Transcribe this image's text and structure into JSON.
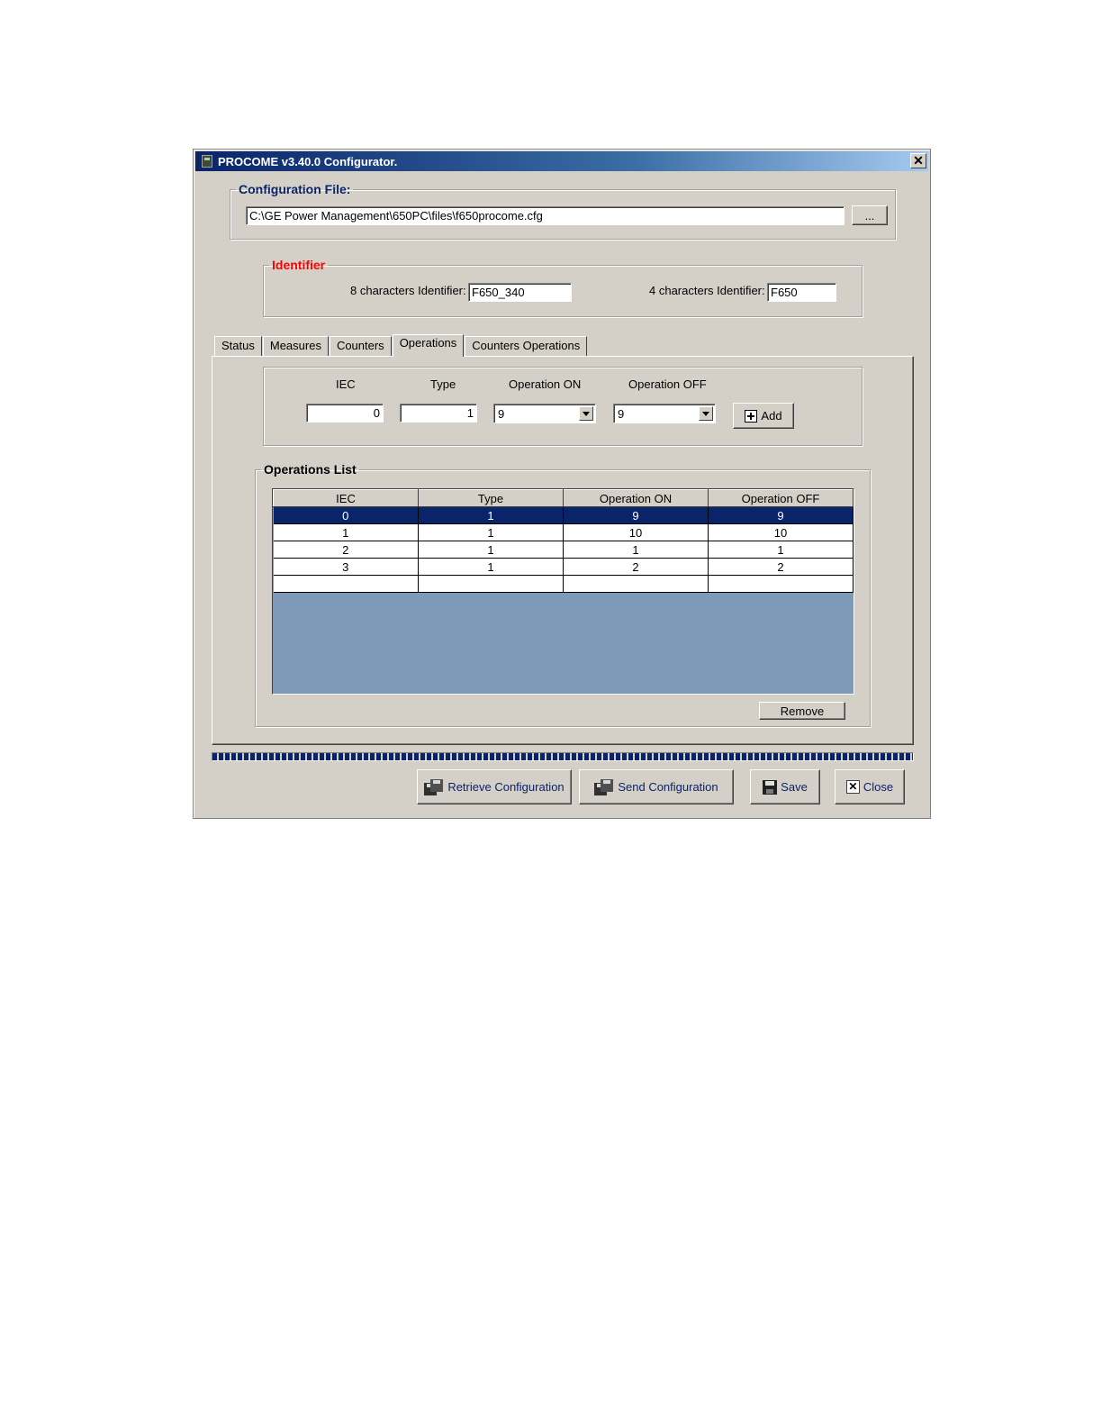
{
  "window": {
    "title": "PROCOME v3.40.0 Configurator."
  },
  "config_file": {
    "legend": "Configuration File:",
    "path": "C:\\GE Power Management\\650PC\\files\\f650procome.cfg",
    "browse_label": "..."
  },
  "identifier": {
    "legend": "Identifier",
    "legend_color": "#ff0000",
    "eight_label": "8 characters Identifier:",
    "eight_value": "F650_340",
    "four_label": "4 characters Identifier:",
    "four_value": "F650"
  },
  "tabs": [
    "Status",
    "Measures",
    "Counters",
    "Operations",
    "Counters Operations"
  ],
  "active_tab": "Operations",
  "entry": {
    "iec_label": "IEC",
    "type_label": "Type",
    "on_label": "Operation ON",
    "off_label": "Operation OFF",
    "iec_value": "0",
    "type_value": "1",
    "on_value": "9",
    "off_value": "9",
    "add_label": "Add"
  },
  "operations_list": {
    "legend": "Operations List",
    "columns": [
      "IEC",
      "Type",
      "Operation ON",
      "Operation OFF"
    ],
    "rows": [
      [
        "0",
        "1",
        "9",
        "9"
      ],
      [
        "1",
        "1",
        "10",
        "10"
      ],
      [
        "2",
        "1",
        "1",
        "1"
      ],
      [
        "3",
        "1",
        "2",
        "2"
      ],
      [
        "",
        "",
        "",
        ""
      ]
    ],
    "selected_row": 0,
    "remove_label": "Remove"
  },
  "footer": {
    "retrieve_label": "Retrieve Configuration",
    "send_label": "Send Configuration",
    "save_label": "Save",
    "close_label": "Close"
  },
  "colors": {
    "selection": "#0a246a",
    "grid_background": "#7f9ab8",
    "legend_text": "#0a246a"
  }
}
